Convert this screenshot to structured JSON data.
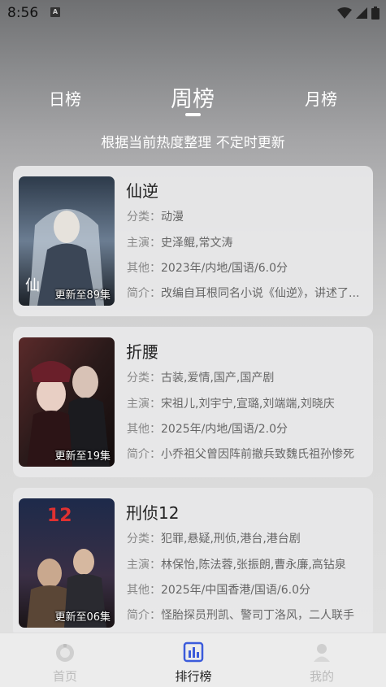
{
  "status": {
    "time": "8:56",
    "app_badge": "A"
  },
  "tabs": [
    {
      "label": "日榜"
    },
    {
      "label": "周榜"
    },
    {
      "label": "月榜"
    }
  ],
  "subtitle": "根据当前热度整理 不定时更新",
  "labels": {
    "category": "分类：",
    "cast": "主演：",
    "other": "其他：",
    "intro": "简介："
  },
  "shows": [
    {
      "title": "仙逆",
      "episode": "更新至89集",
      "category": "动漫",
      "cast": "史泽鲲,常文涛",
      "other": "2023年/内地/国语/6.0分",
      "intro": "改编自耳根同名小说《仙逆》，讲述了..."
    },
    {
      "title": "折腰",
      "episode": "更新至19集",
      "category": "古装,爱情,国产,国产剧",
      "cast": "宋祖儿,刘宇宁,宣璐,刘端端,刘晓庆",
      "other": "2025年/内地/国语/2.0分",
      "intro": "小乔祖父曾因阵前撤兵致魏氏祖孙惨死"
    },
    {
      "title": "刑侦12",
      "episode": "更新至06集",
      "category": "犯罪,悬疑,刑侦,港台,港台剧",
      "cast": "林保怡,陈法蓉,张振朗,曹永廉,高钻泉",
      "other": "2025年/中国香港/国语/6.0分",
      "intro": "怪胎探员刑凯、警司丁洛风，二人联手"
    }
  ],
  "nav": [
    {
      "label": "首页"
    },
    {
      "label": "排行榜"
    },
    {
      "label": "我的"
    }
  ],
  "colors": {
    "active_text": "#222222",
    "inactive_nav": "#bbbbbb",
    "rank_icon": "#3b5bdb"
  }
}
